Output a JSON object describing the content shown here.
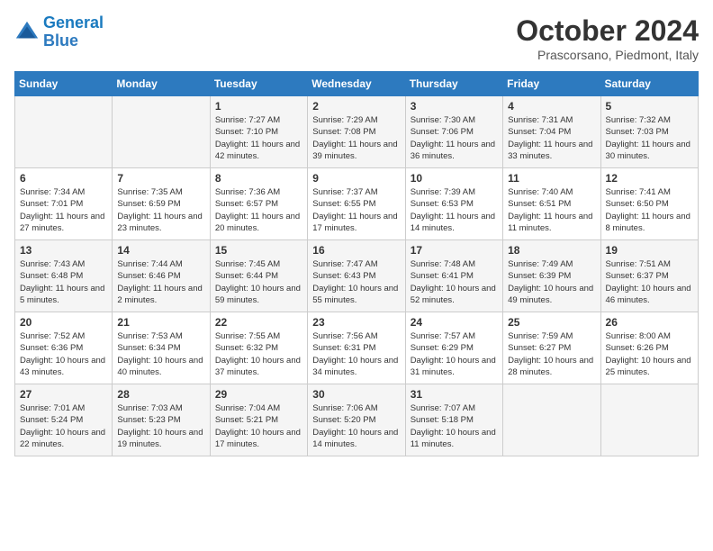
{
  "header": {
    "logo_line1": "General",
    "logo_line2": "Blue",
    "title": "October 2024",
    "subtitle": "Prascorsano, Piedmont, Italy"
  },
  "days_of_week": [
    "Sunday",
    "Monday",
    "Tuesday",
    "Wednesday",
    "Thursday",
    "Friday",
    "Saturday"
  ],
  "weeks": [
    [
      {
        "day": "",
        "info": ""
      },
      {
        "day": "",
        "info": ""
      },
      {
        "day": "1",
        "info": "Sunrise: 7:27 AM\nSunset: 7:10 PM\nDaylight: 11 hours and 42 minutes."
      },
      {
        "day": "2",
        "info": "Sunrise: 7:29 AM\nSunset: 7:08 PM\nDaylight: 11 hours and 39 minutes."
      },
      {
        "day": "3",
        "info": "Sunrise: 7:30 AM\nSunset: 7:06 PM\nDaylight: 11 hours and 36 minutes."
      },
      {
        "day": "4",
        "info": "Sunrise: 7:31 AM\nSunset: 7:04 PM\nDaylight: 11 hours and 33 minutes."
      },
      {
        "day": "5",
        "info": "Sunrise: 7:32 AM\nSunset: 7:03 PM\nDaylight: 11 hours and 30 minutes."
      }
    ],
    [
      {
        "day": "6",
        "info": "Sunrise: 7:34 AM\nSunset: 7:01 PM\nDaylight: 11 hours and 27 minutes."
      },
      {
        "day": "7",
        "info": "Sunrise: 7:35 AM\nSunset: 6:59 PM\nDaylight: 11 hours and 23 minutes."
      },
      {
        "day": "8",
        "info": "Sunrise: 7:36 AM\nSunset: 6:57 PM\nDaylight: 11 hours and 20 minutes."
      },
      {
        "day": "9",
        "info": "Sunrise: 7:37 AM\nSunset: 6:55 PM\nDaylight: 11 hours and 17 minutes."
      },
      {
        "day": "10",
        "info": "Sunrise: 7:39 AM\nSunset: 6:53 PM\nDaylight: 11 hours and 14 minutes."
      },
      {
        "day": "11",
        "info": "Sunrise: 7:40 AM\nSunset: 6:51 PM\nDaylight: 11 hours and 11 minutes."
      },
      {
        "day": "12",
        "info": "Sunrise: 7:41 AM\nSunset: 6:50 PM\nDaylight: 11 hours and 8 minutes."
      }
    ],
    [
      {
        "day": "13",
        "info": "Sunrise: 7:43 AM\nSunset: 6:48 PM\nDaylight: 11 hours and 5 minutes."
      },
      {
        "day": "14",
        "info": "Sunrise: 7:44 AM\nSunset: 6:46 PM\nDaylight: 11 hours and 2 minutes."
      },
      {
        "day": "15",
        "info": "Sunrise: 7:45 AM\nSunset: 6:44 PM\nDaylight: 10 hours and 59 minutes."
      },
      {
        "day": "16",
        "info": "Sunrise: 7:47 AM\nSunset: 6:43 PM\nDaylight: 10 hours and 55 minutes."
      },
      {
        "day": "17",
        "info": "Sunrise: 7:48 AM\nSunset: 6:41 PM\nDaylight: 10 hours and 52 minutes."
      },
      {
        "day": "18",
        "info": "Sunrise: 7:49 AM\nSunset: 6:39 PM\nDaylight: 10 hours and 49 minutes."
      },
      {
        "day": "19",
        "info": "Sunrise: 7:51 AM\nSunset: 6:37 PM\nDaylight: 10 hours and 46 minutes."
      }
    ],
    [
      {
        "day": "20",
        "info": "Sunrise: 7:52 AM\nSunset: 6:36 PM\nDaylight: 10 hours and 43 minutes."
      },
      {
        "day": "21",
        "info": "Sunrise: 7:53 AM\nSunset: 6:34 PM\nDaylight: 10 hours and 40 minutes."
      },
      {
        "day": "22",
        "info": "Sunrise: 7:55 AM\nSunset: 6:32 PM\nDaylight: 10 hours and 37 minutes."
      },
      {
        "day": "23",
        "info": "Sunrise: 7:56 AM\nSunset: 6:31 PM\nDaylight: 10 hours and 34 minutes."
      },
      {
        "day": "24",
        "info": "Sunrise: 7:57 AM\nSunset: 6:29 PM\nDaylight: 10 hours and 31 minutes."
      },
      {
        "day": "25",
        "info": "Sunrise: 7:59 AM\nSunset: 6:27 PM\nDaylight: 10 hours and 28 minutes."
      },
      {
        "day": "26",
        "info": "Sunrise: 8:00 AM\nSunset: 6:26 PM\nDaylight: 10 hours and 25 minutes."
      }
    ],
    [
      {
        "day": "27",
        "info": "Sunrise: 7:01 AM\nSunset: 5:24 PM\nDaylight: 10 hours and 22 minutes."
      },
      {
        "day": "28",
        "info": "Sunrise: 7:03 AM\nSunset: 5:23 PM\nDaylight: 10 hours and 19 minutes."
      },
      {
        "day": "29",
        "info": "Sunrise: 7:04 AM\nSunset: 5:21 PM\nDaylight: 10 hours and 17 minutes."
      },
      {
        "day": "30",
        "info": "Sunrise: 7:06 AM\nSunset: 5:20 PM\nDaylight: 10 hours and 14 minutes."
      },
      {
        "day": "31",
        "info": "Sunrise: 7:07 AM\nSunset: 5:18 PM\nDaylight: 10 hours and 11 minutes."
      },
      {
        "day": "",
        "info": ""
      },
      {
        "day": "",
        "info": ""
      }
    ]
  ]
}
